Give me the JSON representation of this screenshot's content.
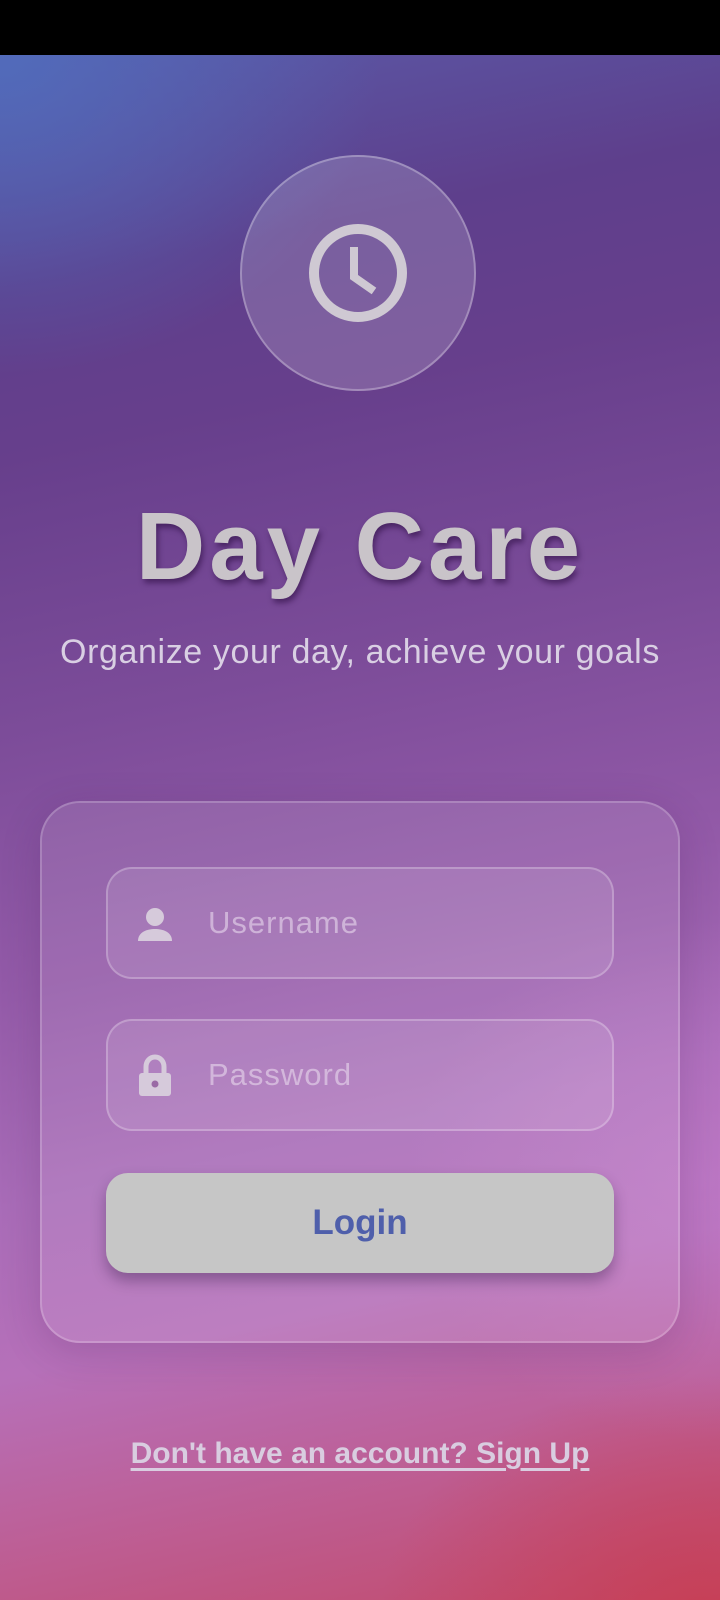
{
  "app": {
    "title": "Day Care",
    "tagline": "Organize your day, achieve your goals",
    "logo_icon": "clock-icon"
  },
  "login_form": {
    "username": {
      "icon": "person-icon",
      "placeholder": "Username",
      "value": ""
    },
    "password": {
      "icon": "lock-icon",
      "placeholder": "Password",
      "value": ""
    },
    "login_label": "Login"
  },
  "signup": {
    "link_text": "Don't have an account? Sign Up"
  },
  "colors": {
    "login_text": "#4f5fab",
    "login_button": "#c6c6c6",
    "gradient_top": "#5a5aa8",
    "gradient_mid": "#935aa8",
    "gradient_bottom": "#c24a6b"
  }
}
